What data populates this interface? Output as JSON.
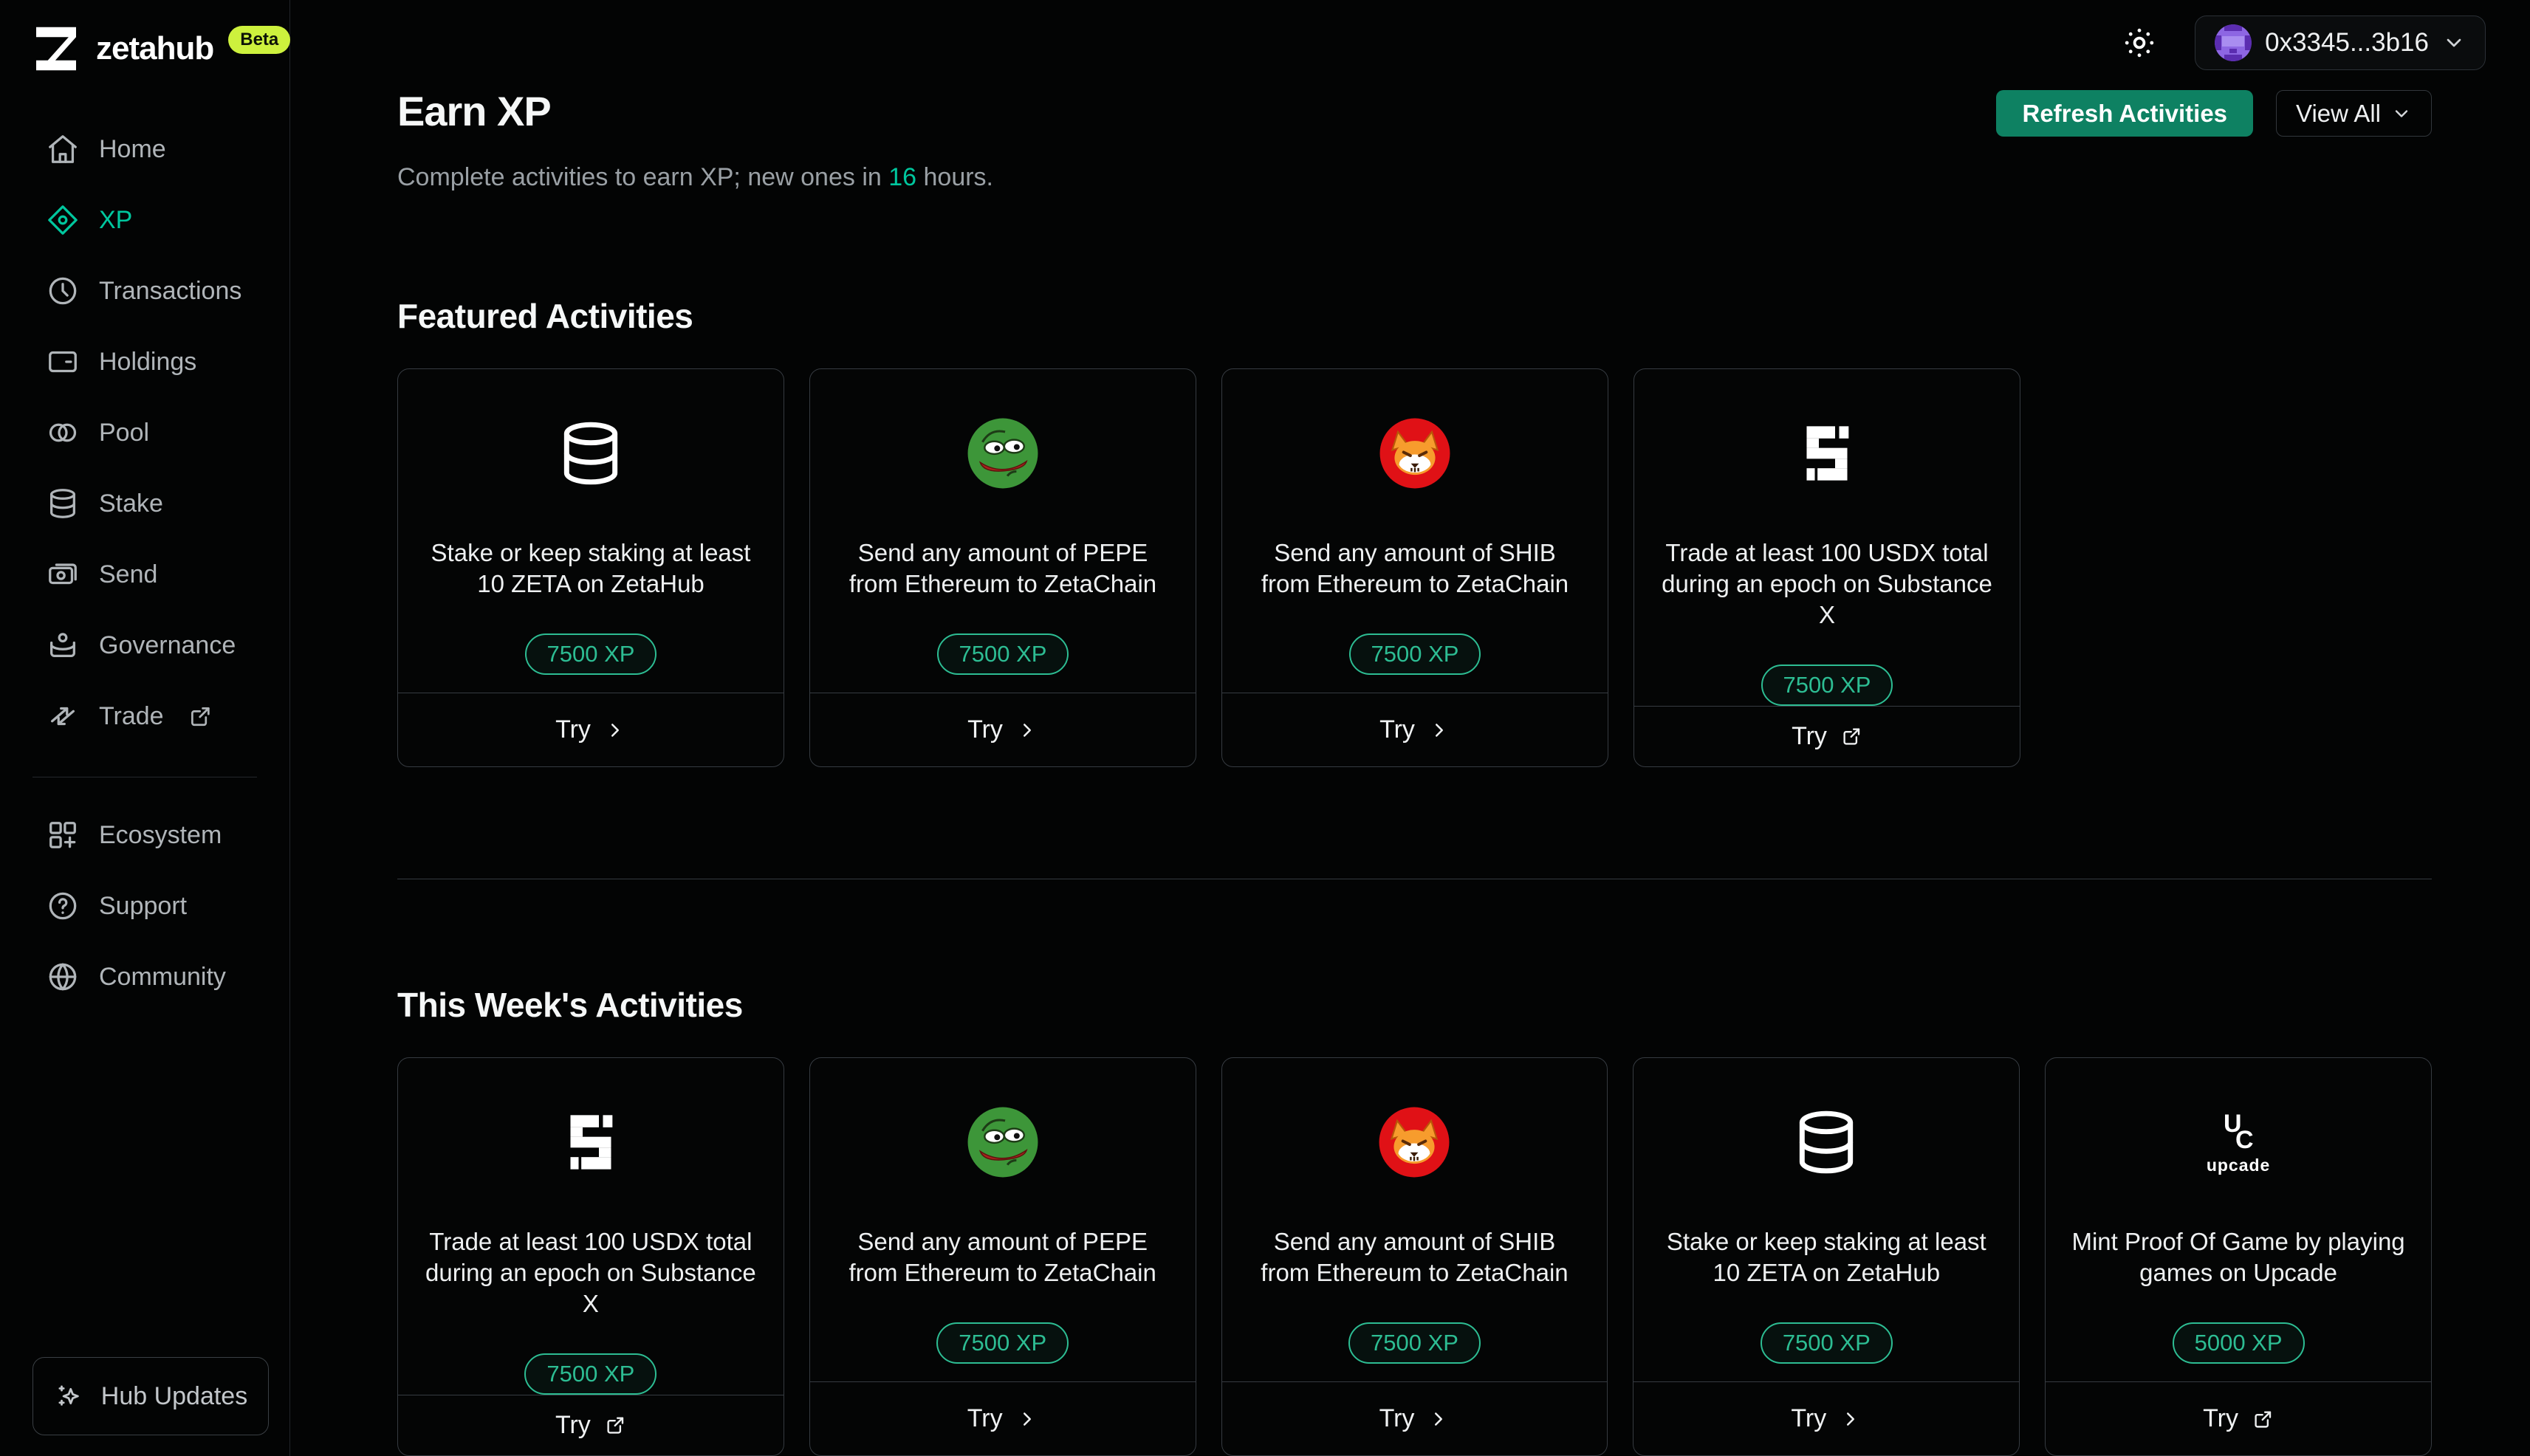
{
  "brand": {
    "name": "zetahub",
    "beta": "Beta"
  },
  "topbar": {
    "wallet_address": "0x3345...3b16"
  },
  "sidebar": {
    "items": [
      {
        "label": "Home"
      },
      {
        "label": "XP"
      },
      {
        "label": "Transactions"
      },
      {
        "label": "Holdings"
      },
      {
        "label": "Pool"
      },
      {
        "label": "Stake"
      },
      {
        "label": "Send"
      },
      {
        "label": "Governance"
      },
      {
        "label": "Trade"
      }
    ],
    "secondary": [
      {
        "label": "Ecosystem"
      },
      {
        "label": "Support"
      },
      {
        "label": "Community"
      }
    ],
    "hub_updates_label": "Hub Updates"
  },
  "page": {
    "title": "Earn XP",
    "subtitle_prefix": "Complete activities to earn XP; new ones in ",
    "subtitle_hours": "16",
    "subtitle_suffix": " hours.",
    "refresh_label": "Refresh Activities",
    "view_all_label": "View All"
  },
  "sections": [
    {
      "title": "Featured Activities",
      "cards": [
        {
          "icon": "database",
          "title": "Stake or keep staking at least 10 ZETA on ZetaHub",
          "xp": "7500 XP",
          "try_label": "Try",
          "external": false
        },
        {
          "icon": "pepe",
          "title": "Send any amount of PEPE from Ethereum to ZetaChain",
          "xp": "7500 XP",
          "try_label": "Try",
          "external": false
        },
        {
          "icon": "shib",
          "title": "Send any amount of SHIB from Ethereum to ZetaChain",
          "xp": "7500 XP",
          "try_label": "Try",
          "external": false
        },
        {
          "icon": "substance-x",
          "title": "Trade at least 100 USDX total during an epoch on Substance X",
          "xp": "7500 XP",
          "try_label": "Try",
          "external": true
        }
      ]
    },
    {
      "title": "This Week's Activities",
      "cards": [
        {
          "icon": "substance-x",
          "title": "Trade at least 100 USDX total during an epoch on Substance X",
          "xp": "7500 XP",
          "try_label": "Try",
          "external": true
        },
        {
          "icon": "pepe",
          "title": "Send any amount of PEPE from Ethereum to ZetaChain",
          "xp": "7500 XP",
          "try_label": "Try",
          "external": false
        },
        {
          "icon": "shib",
          "title": "Send any amount of SHIB from Ethereum to ZetaChain",
          "xp": "7500 XP",
          "try_label": "Try",
          "external": false
        },
        {
          "icon": "database",
          "title": "Stake or keep staking at least 10 ZETA on ZetaHub",
          "xp": "7500 XP",
          "try_label": "Try",
          "external": false
        },
        {
          "icon": "upcade",
          "title": "Mint Proof Of Game by playing games on Upcade",
          "xp": "5000 XP",
          "try_label": "Try",
          "external": true,
          "icon_caption": "upcade"
        }
      ]
    }
  ],
  "colors": {
    "accent_green": "#00c79e",
    "badge_green": "#2dbd93",
    "refresh_button_bg": "#0e8162",
    "beta_badge_bg": "#cdf13d",
    "background": "#030404"
  }
}
